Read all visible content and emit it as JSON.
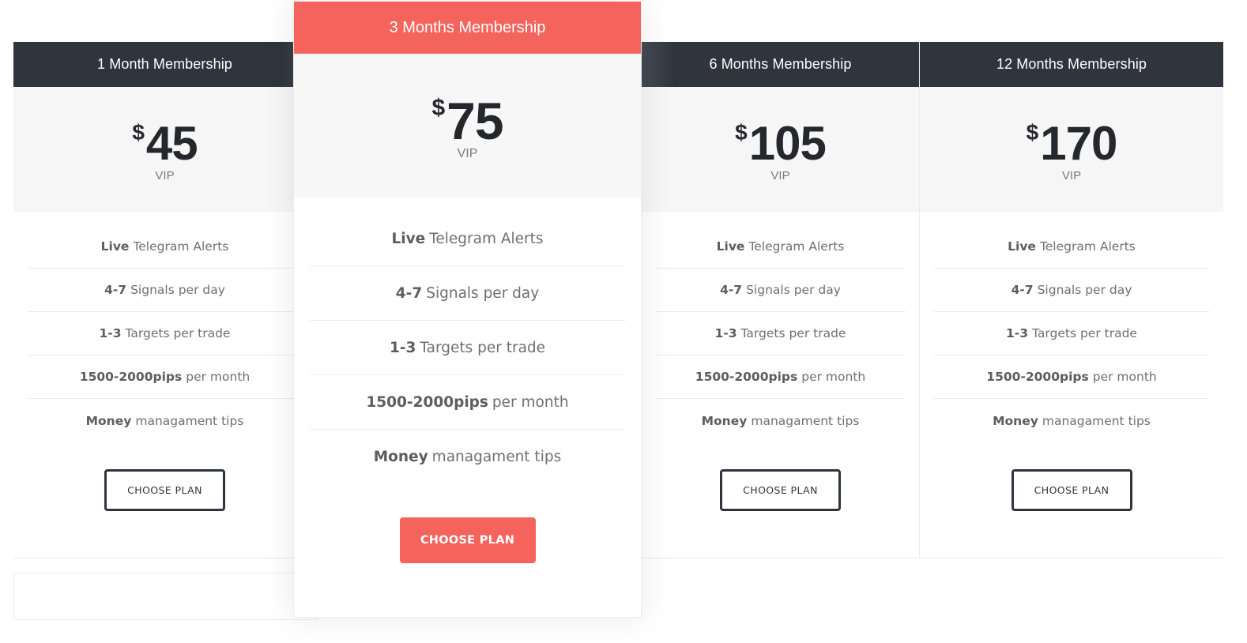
{
  "colors": {
    "header_dark": "#2f343d",
    "accent": "#f4645c",
    "price_bg": "#f6f6f6",
    "feature_text": "#6f6f6f"
  },
  "plans": [
    {
      "title": "1 Month Membership",
      "currency": "$",
      "amount": "45",
      "tier": "VIP",
      "features": [
        {
          "bold": "Live",
          "text": "Telegram Alerts"
        },
        {
          "bold": "4-7",
          "text": "Signals per day"
        },
        {
          "bold": "1-3",
          "text": "Targets per trade"
        },
        {
          "bold": "1500-2000pips",
          "text": "per month"
        },
        {
          "bold": "Money",
          "text": "managament tips"
        }
      ],
      "button": "CHOOSE PLAN"
    },
    {
      "title": "3 Months Membership",
      "currency": "$",
      "amount": "75",
      "tier": "VIP",
      "featured": true,
      "features": [
        {
          "bold": "Live",
          "text": "Telegram Alerts"
        },
        {
          "bold": "4-7",
          "text": "Signals per day"
        },
        {
          "bold": "1-3",
          "text": "Targets per trade"
        },
        {
          "bold": "1500-2000pips",
          "text": "per month"
        },
        {
          "bold": "Money",
          "text": "managament tips"
        }
      ],
      "button": "CHOOSE PLAN"
    },
    {
      "title": "6 Months Membership",
      "currency": "$",
      "amount": "105",
      "tier": "VIP",
      "features": [
        {
          "bold": "Live",
          "text": "Telegram Alerts"
        },
        {
          "bold": "4-7",
          "text": "Signals per day"
        },
        {
          "bold": "1-3",
          "text": "Targets per trade"
        },
        {
          "bold": "1500-2000pips",
          "text": "per month"
        },
        {
          "bold": "Money",
          "text": "managament tips"
        }
      ],
      "button": "CHOOSE PLAN"
    },
    {
      "title": "12 Months Membership",
      "currency": "$",
      "amount": "170",
      "tier": "VIP",
      "features": [
        {
          "bold": "Live",
          "text": "Telegram Alerts"
        },
        {
          "bold": "4-7",
          "text": "Signals per day"
        },
        {
          "bold": "1-3",
          "text": "Targets per trade"
        },
        {
          "bold": "1500-2000pips",
          "text": "per month"
        },
        {
          "bold": "Money",
          "text": "managament tips"
        }
      ],
      "button": "CHOOSE PLAN"
    }
  ]
}
